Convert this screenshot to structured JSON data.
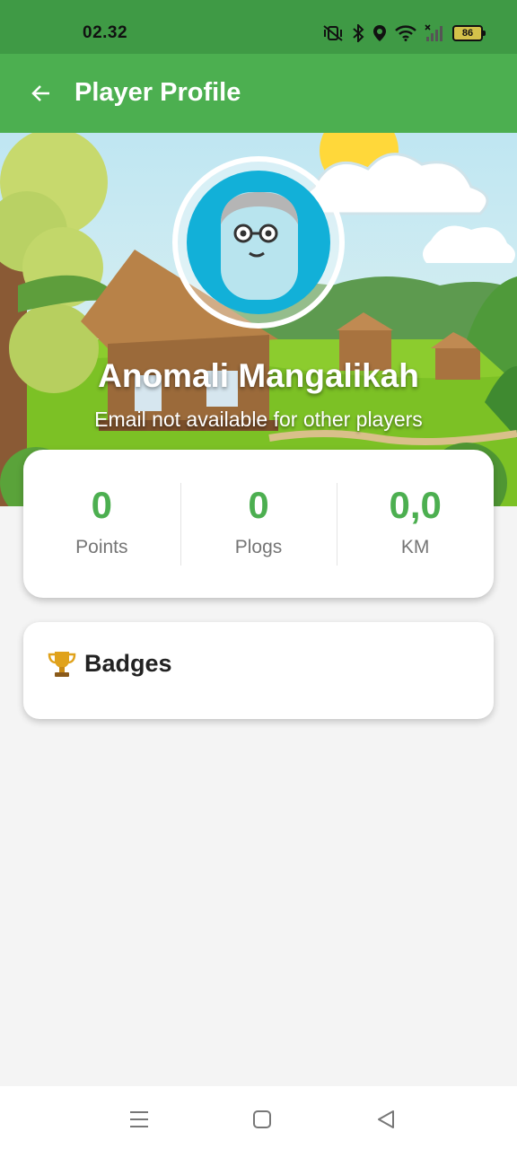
{
  "status_bar": {
    "time": "02.32",
    "battery_level": "86",
    "icons": [
      "mute-vibrate-icon",
      "bluetooth-icon",
      "location-icon",
      "wifi-icon",
      "cell-signal-icon",
      "battery-icon"
    ]
  },
  "app_bar": {
    "back_icon": "arrow-left-icon",
    "title": "Player Profile"
  },
  "profile": {
    "name": "Anomali Mangalikah",
    "email_note": "Email not available for other players"
  },
  "stats": [
    {
      "value": "0",
      "label": "Points"
    },
    {
      "value": "0",
      "label": "Plogs"
    },
    {
      "value": "0,0",
      "label": "KM"
    }
  ],
  "badges": {
    "icon": "trophy-icon",
    "title": "Badges"
  },
  "nav_bar": {
    "icons": [
      "menu-icon",
      "home-square-icon",
      "back-triangle-icon"
    ]
  },
  "colors": {
    "primary": "#4caf50",
    "status_bar": "#3f9a45",
    "avatar_bg": "#12b0d8",
    "background": "#f4f4f4"
  }
}
